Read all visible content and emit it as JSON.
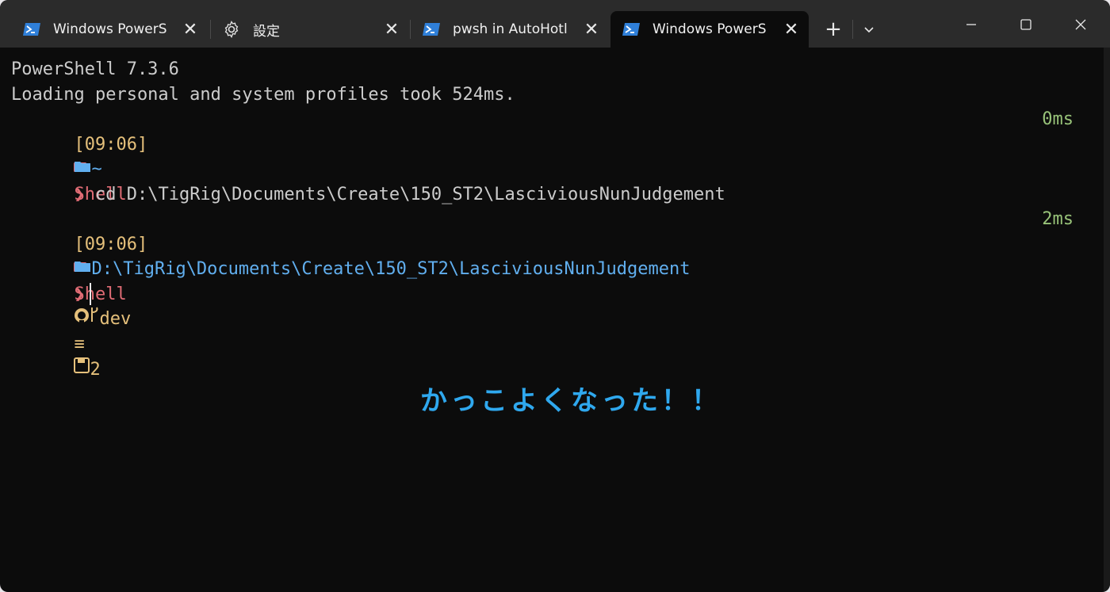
{
  "tabs": [
    {
      "label": "Windows PowerS",
      "icon": "powershell-icon"
    },
    {
      "label": "設定",
      "icon": "gear-icon"
    },
    {
      "label": "pwsh in AutoHotl",
      "icon": "powershell-icon"
    },
    {
      "label": "Windows PowerS",
      "icon": "powershell-icon",
      "active": true
    }
  ],
  "titlebar": {
    "new_tab": "+",
    "close_glyph": "✕"
  },
  "terminal": {
    "banner": "PowerShell 7.3.6",
    "profile_load": "Loading personal and system profiles took 524ms.",
    "prompt1": {
      "time": "[09:06]",
      "shell": "Shell",
      "duration": "0ms",
      "path": "~",
      "chevron": "❯",
      "command": "cd D:\\TigRig\\Documents\\Create\\150_ST2\\LasciviousNunJudgement"
    },
    "prompt2": {
      "time": "[09:06]",
      "shell": "Shell",
      "branch": "dev",
      "git_ahead": "≡",
      "stash_count": "2",
      "duration": "2ms",
      "path": "D:\\TigRig\\Documents\\Create\\150_ST2\\LasciviousNunJudgement",
      "chevron": "❯"
    }
  },
  "caption": "かっこよくなった！！",
  "colors": {
    "accent": "#2fa8ee",
    "background": "#0c0c0c",
    "titlebar": "#2b2b2b"
  }
}
